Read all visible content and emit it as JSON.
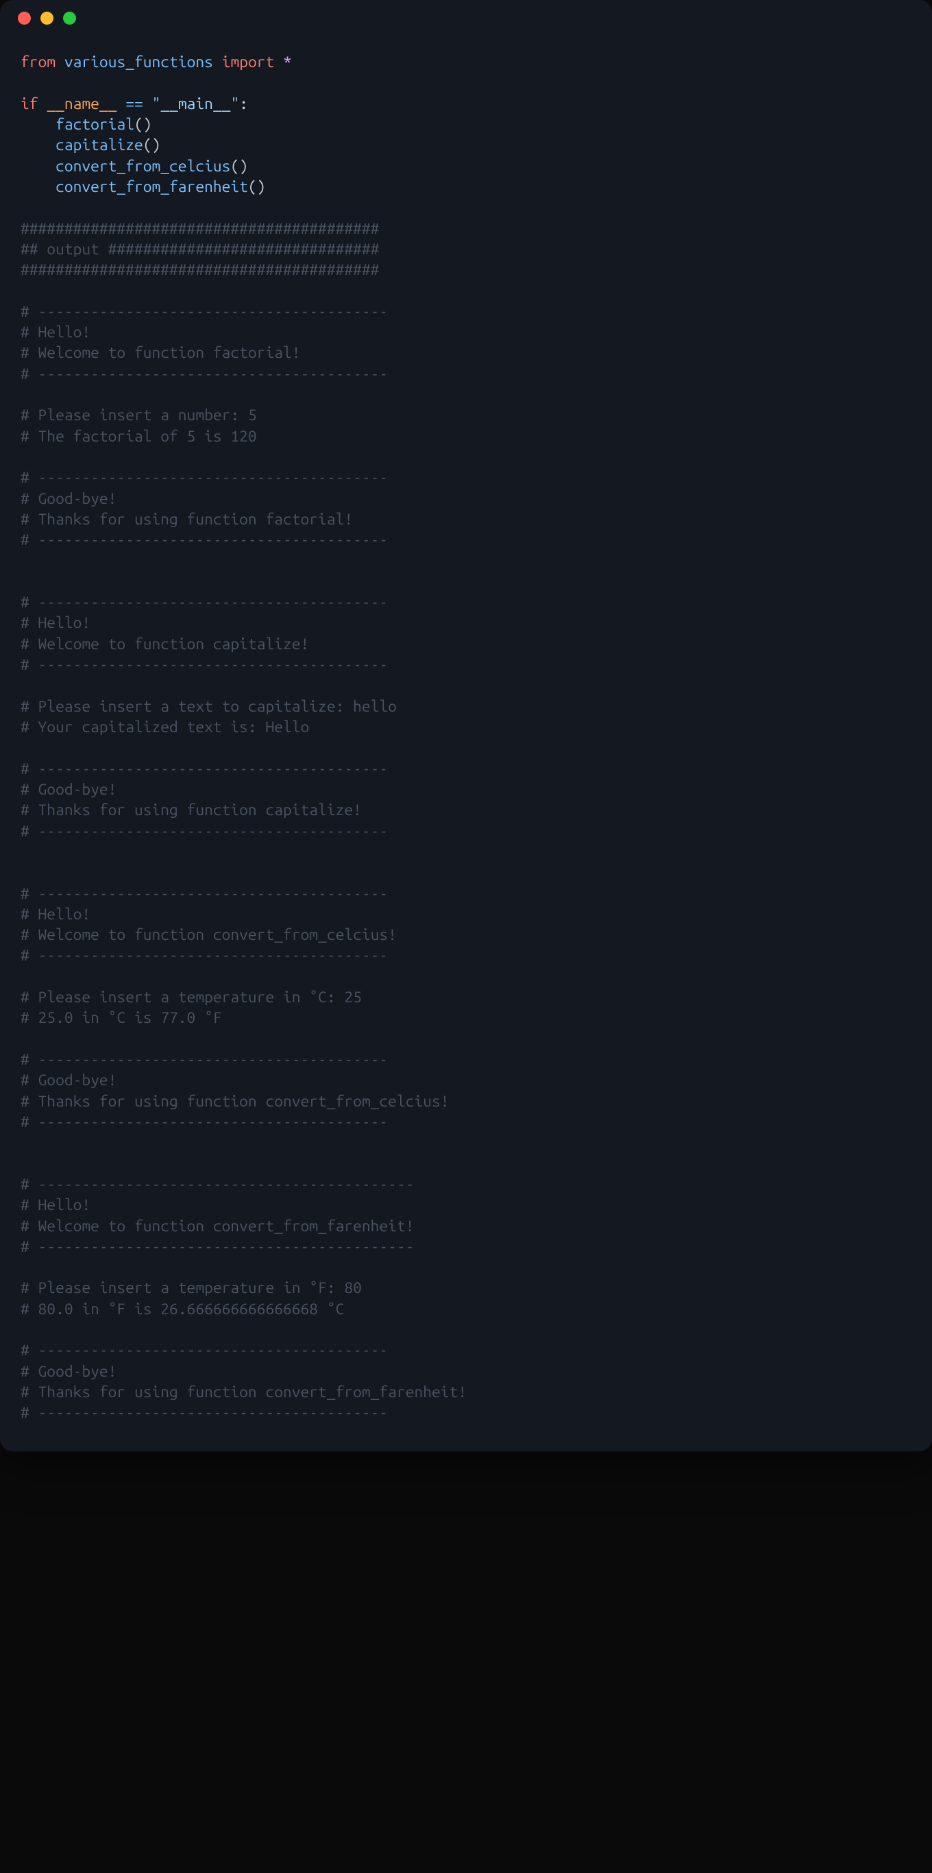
{
  "code": {
    "line1": {
      "from": "from",
      "module": "various_functions",
      "import": "import",
      "star": "*"
    },
    "line3": {
      "if": "if",
      "name": "__name__",
      "eq": "==",
      "main": "\"__main__\"",
      "colon": ":"
    },
    "calls": {
      "factorial": "factorial",
      "capitalize": "capitalize",
      "convert_c": "convert_from_celcius",
      "convert_f": "convert_from_farenheit",
      "parens": "()"
    }
  },
  "comments": {
    "hashbar1": "#########################################",
    "output_label": "## output ###############################",
    "hashbar2": "#########################################",
    "dashbar": "# ----------------------------------------",
    "dashbar_long": "# -------------------------------------------",
    "hello": "# Hello!",
    "goodbye": "# Good-bye!",
    "factorial": {
      "welcome": "# Welcome to function factorial!",
      "insert": "# Please insert a number: 5",
      "result": "# The factorial of 5 is 120",
      "thanks": "# Thanks for using function factorial!"
    },
    "capitalize": {
      "welcome": "# Welcome to function capitalize!",
      "insert": "# Please insert a text to capitalize: hello",
      "result": "# Your capitalized text is: Hello",
      "thanks": "# Thanks for using function capitalize!"
    },
    "celcius": {
      "welcome": "# Welcome to function convert_from_celcius!",
      "insert": "# Please insert a temperature in °C: 25",
      "result": "# 25.0 in °C is 77.0 °F",
      "thanks": "# Thanks for using function convert_from_celcius!"
    },
    "farenheit": {
      "welcome": "# Welcome to function convert_from_farenheit!",
      "insert": "# Please insert a temperature in °F: 80",
      "result": "# 80.0 in °F is 26.666666666666668 °C",
      "thanks": "# Thanks for using function convert_from_farenheit!"
    }
  }
}
